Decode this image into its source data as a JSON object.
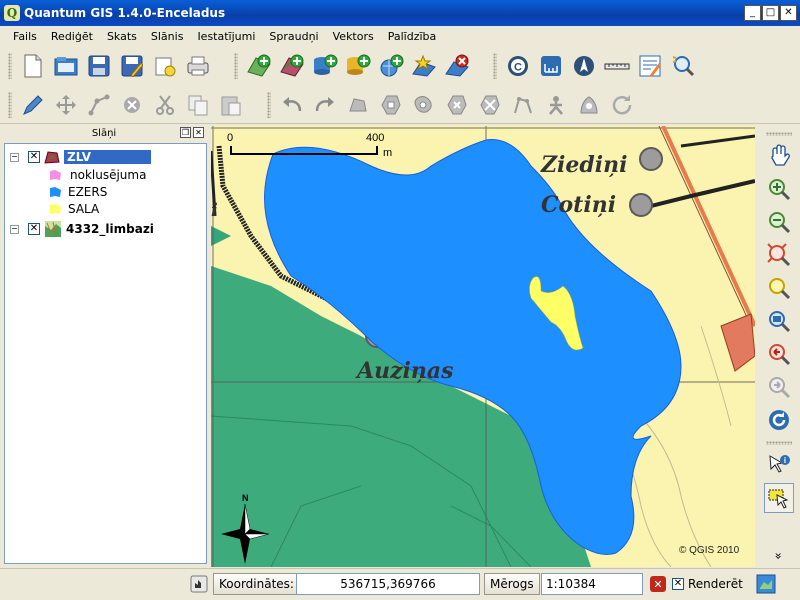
{
  "window": {
    "title": "Quantum GIS 1.4.0-Enceladus",
    "app_icon": "Q",
    "minimize": "_",
    "maximize": "□",
    "close": "✕"
  },
  "menu": {
    "items": [
      "Fails",
      "Rediģēt",
      "Skats",
      "Slānis",
      "Iestatījumi",
      "Spraudņi",
      "Vektors",
      "Palīdzība"
    ]
  },
  "toolbar1": {
    "icons": [
      "new-project-icon",
      "open-project-icon",
      "save-project-icon",
      "save-as-icon",
      "new-print-composer-icon",
      "print-icon",
      "add-vector-layer-icon",
      "add-raster-layer-icon",
      "add-postgis-layer-icon",
      "add-spatialite-layer-icon",
      "add-wms-layer-icon",
      "new-shapefile-icon",
      "remove-layer-icon",
      "copyright-label-icon",
      "scale-bar-icon",
      "north-arrow-icon",
      "measure-line-icon",
      "edit-label-icon",
      "identify-zoom-icon"
    ]
  },
  "toolbar2": {
    "icons": [
      "toggle-editing-icon",
      "move-feature-icon",
      "node-tool-icon",
      "delete-selected-icon",
      "cut-features-icon",
      "copy-features-icon",
      "paste-features-icon",
      "undo-icon",
      "redo-icon",
      "simplify-feature-icon",
      "add-ring-icon",
      "add-island-icon",
      "delete-ring-icon",
      "delete-part-icon",
      "reshape-features-icon",
      "split-features-icon",
      "merge-features-icon",
      "merge-attributes-icon",
      "rotate-point-symbols-icon"
    ]
  },
  "layers_panel": {
    "title": "Slāņi",
    "layers": [
      {
        "name": "ZLV",
        "checked": "✕",
        "expander": "−",
        "selected": true,
        "classes": [
          {
            "label": "noklusējuma",
            "color": "#f58ee6"
          },
          {
            "label": "EZERS",
            "color": "#1e8fff"
          },
          {
            "label": "SALA",
            "color": "#ffff66"
          }
        ]
      },
      {
        "name": "4332_limbazi",
        "checked": "✕",
        "expander": "−",
        "selected": false,
        "classes": []
      }
    ]
  },
  "map": {
    "scale_bar": {
      "start": "0",
      "end": "400",
      "unit": "m"
    },
    "labels": {
      "place1": "Ziediņi",
      "place2": "Cotiņi",
      "place3": "Auziņas"
    },
    "north_letter": "N",
    "copyright": "© QGIS 2010",
    "colors": {
      "land": "#fbf4b0",
      "forest": "#34a67a",
      "lake": "#1e8fff",
      "island": "#ffff66",
      "road": "#222222"
    }
  },
  "right_toolbar": {
    "icons": [
      "pan-icon",
      "zoom-in-icon",
      "zoom-out-icon",
      "zoom-full-icon",
      "zoom-to-layer-icon",
      "zoom-to-selection-icon",
      "zoom-last-icon",
      "zoom-next-icon",
      "refresh-icon",
      "identify-icon",
      "select-features-icon"
    ],
    "more": "»"
  },
  "statusbar": {
    "coordinates_label": "Koordinātes:",
    "coordinates_value": "536715,369766",
    "scale_label": "Mērogs",
    "scale_value": "1:10384",
    "render_label": "Renderēt",
    "render_checked": "✕"
  }
}
